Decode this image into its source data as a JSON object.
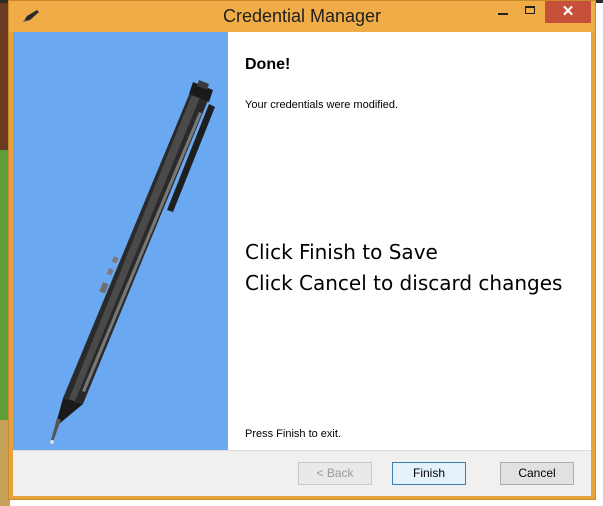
{
  "window": {
    "title": "Credential Manager",
    "close_glyph": "✕",
    "icons": [
      "pen-app-icon",
      "minimize-icon",
      "maximize-icon",
      "close-icon"
    ]
  },
  "content": {
    "heading": "Done!",
    "subtext": "Your credentials were modified.",
    "message_lines": [
      "Click Finish to Save",
      "Click Cancel to discard changes"
    ],
    "exit_text": "Press Finish to exit."
  },
  "footer": {
    "back_label": "< Back",
    "finish_label": "Finish",
    "cancel_label": "Cancel"
  },
  "colors": {
    "titlebar": "#f0ac47",
    "side_panel": "#6aa9f1",
    "close_button": "#c7503a"
  }
}
